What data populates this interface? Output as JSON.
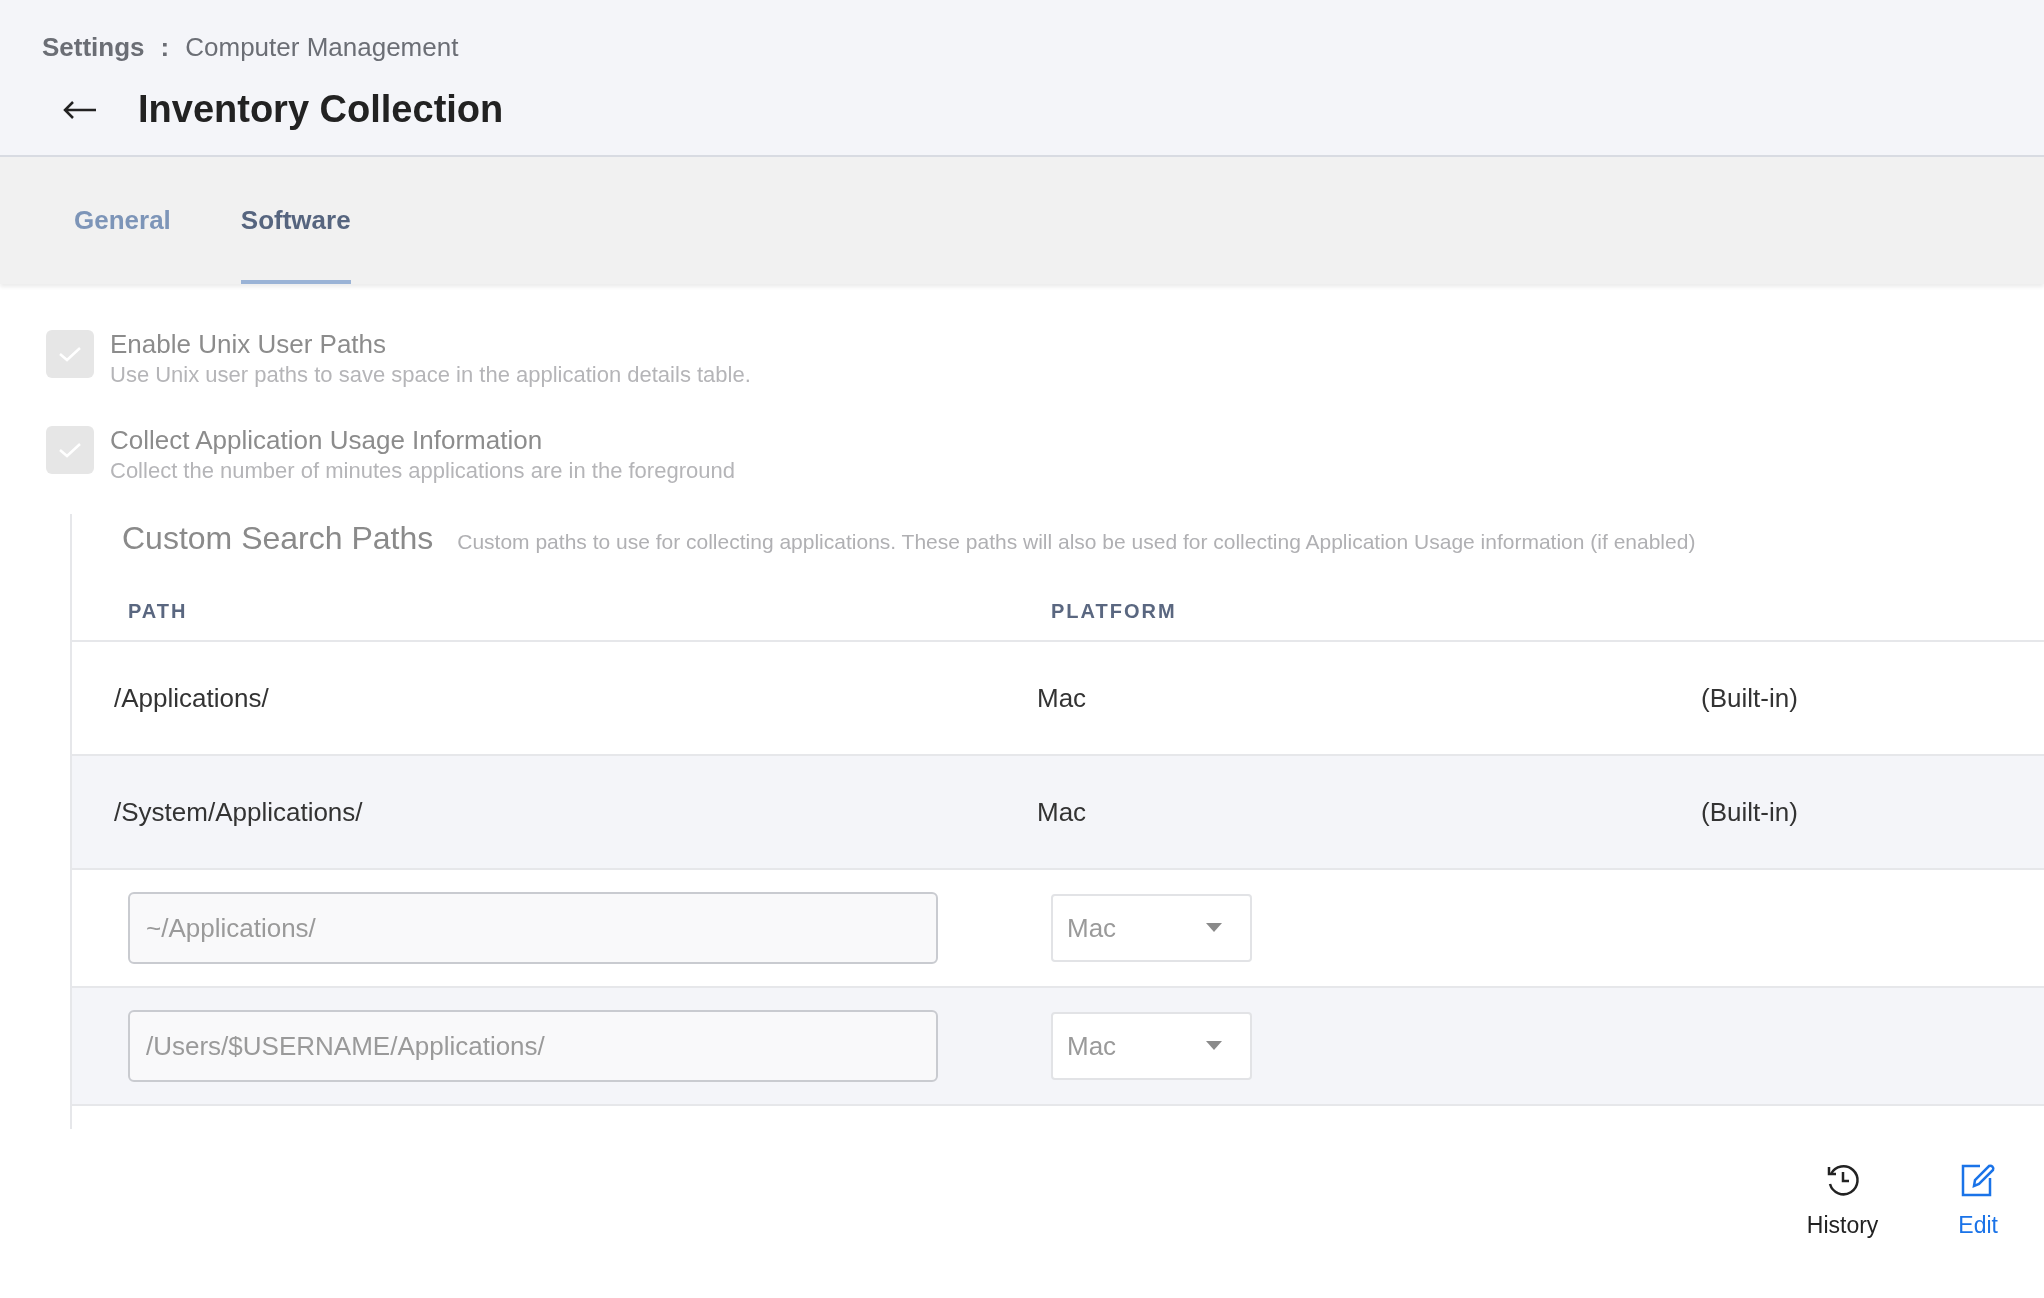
{
  "breadcrumb": {
    "parent": "Settings",
    "separator": ":",
    "current": "Computer Management"
  },
  "page_title": "Inventory Collection",
  "tabs": [
    {
      "label": "General",
      "selected": false
    },
    {
      "label": "Software",
      "selected": true
    }
  ],
  "options": [
    {
      "label": "Enable Unix User Paths",
      "description": "Use Unix user paths to save space in the application details table.",
      "checked": true
    },
    {
      "label": "Collect Application Usage Information",
      "description": "Collect the number of minutes applications are in the foreground",
      "checked": true
    }
  ],
  "search_paths": {
    "title": "Custom Search Paths",
    "description": "Custom paths to use for collecting applications. These paths will also be used for collecting Application Usage information (if enabled)",
    "columns": [
      "PATH",
      "PLATFORM"
    ],
    "rows": [
      {
        "kind": "builtin",
        "path": "/Applications/",
        "platform": "Mac",
        "note": "(Built-in)"
      },
      {
        "kind": "builtin",
        "path": "/System/Applications/",
        "platform": "Mac",
        "note": "(Built-in)"
      },
      {
        "kind": "custom",
        "path": "~/Applications/",
        "platform": "Mac"
      },
      {
        "kind": "custom",
        "path": "/Users/$USERNAME/Applications/",
        "platform": "Mac"
      }
    ]
  },
  "actions": [
    {
      "kind": "history",
      "label": "History"
    },
    {
      "kind": "edit",
      "label": "Edit"
    }
  ]
}
